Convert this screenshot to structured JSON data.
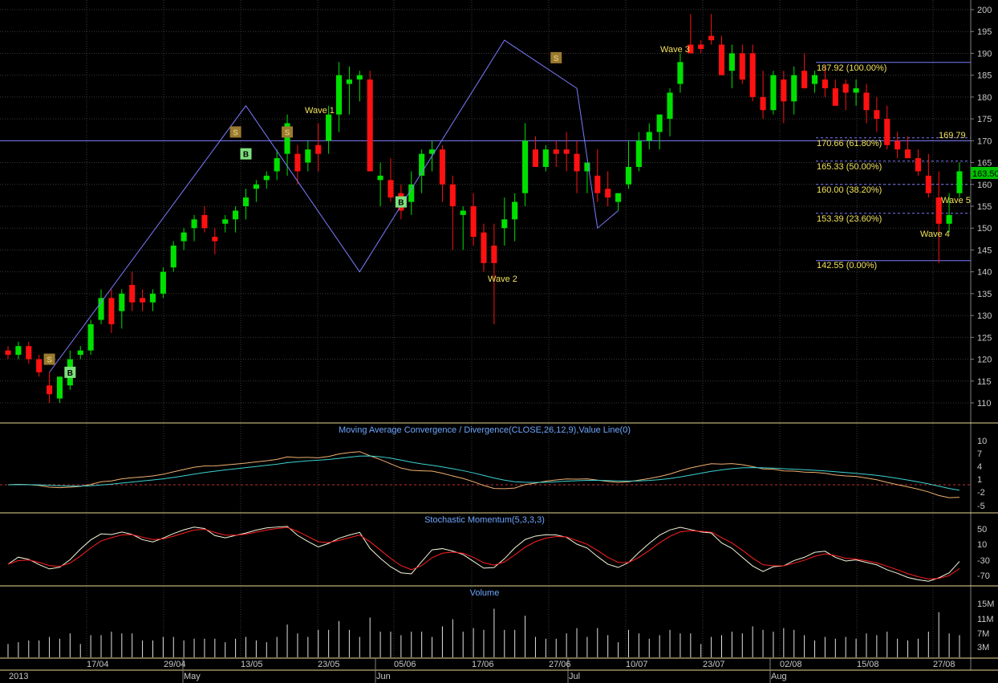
{
  "chart_data": {
    "type": "candlestick",
    "price_axis": {
      "ticks": [
        110,
        115,
        120,
        125,
        130,
        135,
        140,
        145,
        150,
        155,
        160,
        165,
        170,
        175,
        180,
        185,
        190,
        195,
        200
      ],
      "range": [
        105,
        201
      ]
    },
    "last_price_label": "163.50",
    "horizontal_line": {
      "value": 170,
      "label": "169.79"
    },
    "fibonacci": [
      {
        "value": 187.92,
        "label": "187.92 (100.00%)",
        "style": "solid"
      },
      {
        "value": 170.66,
        "label": "170.66 (61.80%)",
        "style": "dashed"
      },
      {
        "value": 165.33,
        "label": "165.33 (50.00%)",
        "style": "dashed"
      },
      {
        "value": 160.0,
        "label": "160.00 (38.20%)",
        "style": "dashed"
      },
      {
        "value": 153.39,
        "label": "153.39 (23.60%)",
        "style": "dashed"
      },
      {
        "value": 142.55,
        "label": "142.55 (0.00%)",
        "style": "solid"
      }
    ],
    "wave_labels": [
      "Wave 1",
      "Wave 2",
      "Wave 3",
      "Wave 4",
      "Wave 5"
    ],
    "wave_points": [
      {
        "i": 4,
        "price": 117
      },
      {
        "i": 23,
        "price": 178
      },
      {
        "i": 34,
        "price": 140
      },
      {
        "i": 48,
        "price": 193
      },
      {
        "i": 55,
        "price": 182
      },
      {
        "i": 57,
        "price": 150
      },
      {
        "i": 59,
        "price": 154
      }
    ],
    "signals": [
      {
        "type": "S",
        "i": 4,
        "price": 120
      },
      {
        "type": "B",
        "i": 6,
        "price": 117
      },
      {
        "type": "S",
        "i": 22,
        "price": 172
      },
      {
        "type": "B",
        "i": 23,
        "price": 167
      },
      {
        "type": "S",
        "i": 27,
        "price": 172
      },
      {
        "type": "B",
        "i": 38,
        "price": 156
      },
      {
        "type": "S",
        "i": 53,
        "price": 189
      }
    ],
    "candles": [
      [
        122,
        123,
        120,
        121
      ],
      [
        121,
        124,
        120,
        123
      ],
      [
        123,
        124,
        119,
        120
      ],
      [
        120,
        121,
        116,
        117
      ],
      [
        114,
        117,
        110,
        112
      ],
      [
        111,
        116,
        110,
        116
      ],
      [
        114,
        122,
        113,
        120
      ],
      [
        121,
        123,
        120,
        122
      ],
      [
        122,
        129,
        121,
        128
      ],
      [
        129,
        136,
        128,
        134
      ],
      [
        134,
        136,
        126,
        128
      ],
      [
        131,
        136,
        127,
        135
      ],
      [
        137,
        140,
        131,
        133
      ],
      [
        134,
        136,
        131,
        133
      ],
      [
        133,
        136,
        131,
        135
      ],
      [
        135,
        141,
        134,
        140
      ],
      [
        141,
        147,
        140,
        146
      ],
      [
        147,
        150,
        145,
        149
      ],
      [
        150,
        153,
        147,
        152
      ],
      [
        153,
        155,
        149,
        150
      ],
      [
        148,
        150,
        144,
        147
      ],
      [
        151,
        153,
        149,
        152
      ],
      [
        152,
        155,
        149,
        154
      ],
      [
        155,
        159,
        152,
        157
      ],
      [
        159,
        161,
        156,
        160
      ],
      [
        161,
        163,
        159,
        162
      ],
      [
        163,
        168,
        161,
        166
      ],
      [
        167,
        176,
        162,
        174
      ],
      [
        167,
        169,
        160,
        163
      ],
      [
        165,
        170,
        163,
        168
      ],
      [
        169,
        174,
        163,
        167
      ],
      [
        170,
        178,
        167,
        176
      ],
      [
        176,
        188,
        172,
        185
      ],
      [
        183,
        187,
        176,
        184
      ],
      [
        184,
        186,
        179,
        185
      ],
      [
        184,
        186,
        168,
        163
      ],
      [
        161,
        165,
        155,
        162
      ],
      [
        161,
        166,
        156,
        157
      ],
      [
        158,
        160,
        152,
        154
      ],
      [
        156,
        163,
        153,
        160
      ],
      [
        162,
        168,
        158,
        167
      ],
      [
        167,
        170,
        163,
        168
      ],
      [
        168,
        169,
        156,
        160
      ],
      [
        160,
        162,
        145,
        155
      ],
      [
        153,
        155,
        145,
        154
      ],
      [
        155,
        158,
        146,
        148
      ],
      [
        149,
        151,
        140,
        142
      ],
      [
        146,
        151,
        128,
        142
      ],
      [
        150,
        157,
        146,
        152
      ],
      [
        152,
        158,
        147,
        156
      ],
      [
        158,
        174,
        155,
        170
      ],
      [
        168,
        171,
        164,
        164
      ],
      [
        164,
        169,
        163,
        168
      ],
      [
        168,
        170,
        164,
        167
      ],
      [
        168,
        172,
        163,
        167
      ],
      [
        167,
        170,
        158,
        163
      ],
      [
        163,
        165,
        158,
        165
      ],
      [
        162,
        168,
        156,
        158
      ],
      [
        159,
        163,
        155,
        157
      ],
      [
        156,
        158,
        154,
        158
      ],
      [
        160,
        170,
        159,
        164
      ],
      [
        164,
        172,
        163,
        170
      ],
      [
        170,
        174,
        168,
        172
      ],
      [
        172,
        176,
        168,
        176
      ],
      [
        175,
        182,
        171,
        181
      ],
      [
        183,
        190,
        181,
        188
      ],
      [
        192,
        199,
        190,
        190
      ],
      [
        192,
        193,
        190,
        191
      ],
      [
        194,
        199,
        192,
        193
      ],
      [
        192,
        194,
        186,
        185
      ],
      [
        186,
        192,
        182,
        190
      ],
      [
        190,
        192,
        183,
        184
      ],
      [
        190,
        192,
        179,
        180
      ],
      [
        180,
        186,
        175,
        177
      ],
      [
        177,
        186,
        176,
        185
      ],
      [
        184,
        186,
        174,
        179
      ],
      [
        179,
        187,
        176,
        185
      ],
      [
        186,
        190,
        182,
        182
      ],
      [
        183,
        186,
        181,
        185
      ],
      [
        184,
        187,
        180,
        182
      ],
      [
        182,
        184,
        178,
        178
      ],
      [
        183,
        184,
        177,
        181
      ],
      [
        181,
        184,
        178,
        182
      ],
      [
        181,
        183,
        174,
        177
      ],
      [
        177,
        180,
        172,
        175
      ],
      [
        175,
        178,
        168,
        169
      ],
      [
        170,
        172,
        166,
        168
      ],
      [
        168,
        171,
        166,
        166
      ],
      [
        166,
        168,
        162,
        163
      ],
      [
        162,
        167,
        157,
        158
      ],
      [
        157,
        163,
        142,
        151
      ],
      [
        151,
        158,
        149,
        153
      ],
      [
        158,
        165,
        157,
        163
      ]
    ],
    "panels": [
      {
        "title": "Moving Average Convergence / Divergence(CLOSE,26,12,9),Value Line(0)",
        "ticks": [
          "10",
          "7",
          "4",
          "1",
          "-2",
          "-5"
        ]
      },
      {
        "title": "Stochastic Momentum(5,3,3,3)",
        "ticks": [
          "50",
          "10",
          "-30",
          "-70"
        ]
      },
      {
        "title": "Volume",
        "ticks": [
          "15M",
          "11M",
          "7M",
          "3M"
        ]
      }
    ],
    "x_axis": {
      "top_row": [
        "17/04",
        "29/04",
        "13/05",
        "23/05",
        "05/06",
        "17/06",
        "27/06",
        "10/07",
        "23/07",
        "02/08",
        "15/08",
        "27/08"
      ],
      "bottom_row": [
        "2013",
        "May",
        "Jun",
        "Jul",
        "Aug"
      ]
    },
    "colors": {
      "up": "#00e000",
      "down": "#ff1111",
      "grid": "#3a3a3a",
      "axis_text": "#c8c8c8",
      "separator": "#e8d890",
      "wave_line": "#7b7bff",
      "fib": "#f2e25c",
      "macd": "#3cd2d2",
      "signal": "#f0b070",
      "stoch_k": "#f5f5dc",
      "stoch_d": "#ff2020",
      "panel_title": "#6da6ff"
    }
  }
}
